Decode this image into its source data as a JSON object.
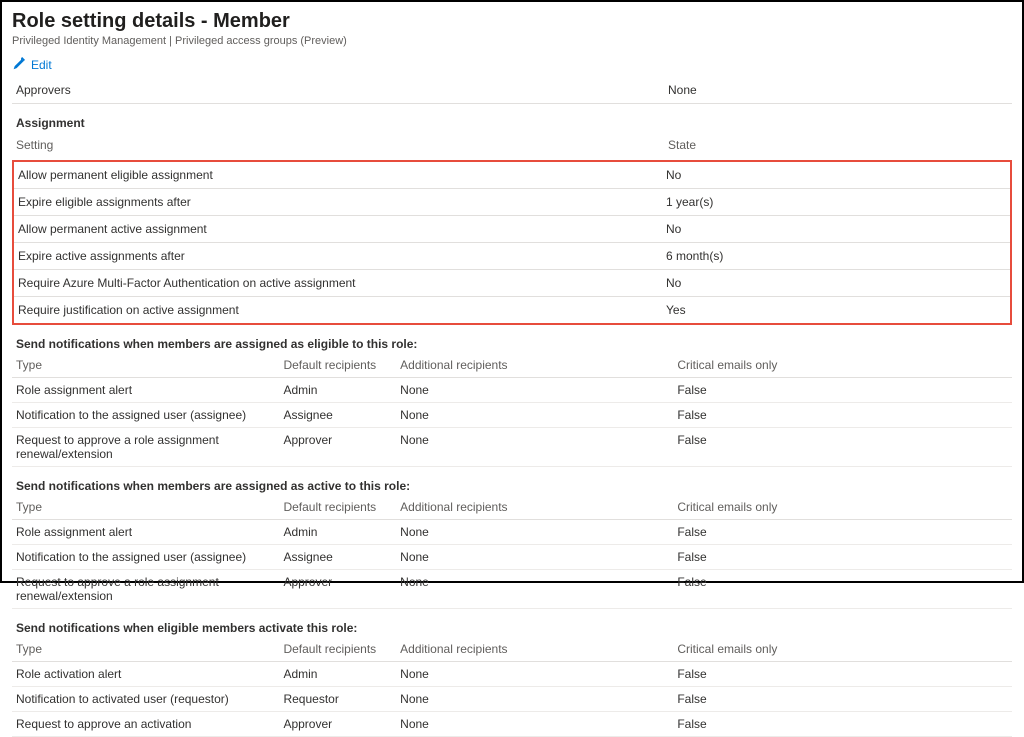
{
  "header": {
    "title": "Role setting details - Member",
    "breadcrumb": "Privileged Identity Management | Privileged access groups (Preview)",
    "editLabel": "Edit"
  },
  "approvers": {
    "label": "Approvers",
    "value": "None"
  },
  "assignment": {
    "title": "Assignment",
    "headers": {
      "setting": "Setting",
      "state": "State"
    },
    "rows": [
      {
        "setting": "Allow permanent eligible assignment",
        "state": "No"
      },
      {
        "setting": "Expire eligible assignments after",
        "state": "1 year(s)"
      },
      {
        "setting": "Allow permanent active assignment",
        "state": "No"
      },
      {
        "setting": "Expire active assignments after",
        "state": "6 month(s)"
      },
      {
        "setting": "Require Azure Multi-Factor Authentication on active assignment",
        "state": "No"
      },
      {
        "setting": "Require justification on active assignment",
        "state": "Yes"
      }
    ]
  },
  "notif": {
    "headers": {
      "type": "Type",
      "default": "Default recipients",
      "additional": "Additional recipients",
      "critical": "Critical emails only"
    },
    "sections": [
      {
        "title": "Send notifications when members are assigned as eligible to this role:",
        "rows": [
          {
            "type": "Role assignment alert",
            "default": "Admin",
            "additional": "None",
            "critical": "False"
          },
          {
            "type": "Notification to the assigned user (assignee)",
            "default": "Assignee",
            "additional": "None",
            "critical": "False"
          },
          {
            "type": "Request to approve a role assignment renewal/extension",
            "default": "Approver",
            "additional": "None",
            "critical": "False"
          }
        ]
      },
      {
        "title": "Send notifications when members are assigned as active to this role:",
        "rows": [
          {
            "type": "Role assignment alert",
            "default": "Admin",
            "additional": "None",
            "critical": "False"
          },
          {
            "type": "Notification to the assigned user (assignee)",
            "default": "Assignee",
            "additional": "None",
            "critical": "False"
          },
          {
            "type": "Request to approve a role assignment renewal/extension",
            "default": "Approver",
            "additional": "None",
            "critical": "False"
          }
        ]
      },
      {
        "title": "Send notifications when eligible members activate this role:",
        "rows": [
          {
            "type": "Role activation alert",
            "default": "Admin",
            "additional": "None",
            "critical": "False"
          },
          {
            "type": "Notification to activated user (requestor)",
            "default": "Requestor",
            "additional": "None",
            "critical": "False"
          },
          {
            "type": "Request to approve an activation",
            "default": "Approver",
            "additional": "None",
            "critical": "False"
          }
        ]
      }
    ]
  }
}
